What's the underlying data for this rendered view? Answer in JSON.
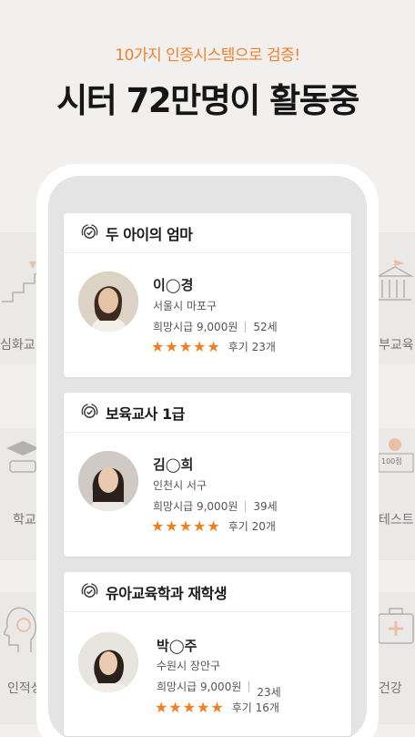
{
  "header": {
    "subtitle": "10가지 인증시스템으로 검증!",
    "title": "시터 72만명이 활동중"
  },
  "background": {
    "left_labels": [
      "심화교",
      "학교",
      "인적성"
    ],
    "right_labels": [
      "부교육",
      "테스트",
      "건강"
    ],
    "score_badge": "100점"
  },
  "cards": [
    {
      "title": "두 아이의 엄마",
      "name": "이◯경",
      "location": "서울시 마포구",
      "wage": "희망시급 9,000원",
      "age": "52세",
      "rating": 5,
      "reviews": "후기 23개"
    },
    {
      "title": "보육교사 1급",
      "name": "김◯희",
      "location": "인천시 서구",
      "wage": "희망시급 9,000원",
      "age": "39세",
      "rating": 5,
      "reviews": "후기 20개"
    },
    {
      "title": "유아교육학과 재학생",
      "name": "박◯주",
      "location": "수원시 장안구",
      "wage": "희망시급 9,000원",
      "age": "23세",
      "rating": 5,
      "reviews": "후기 16개"
    }
  ],
  "colors": {
    "accent": "#f0812a",
    "star": "#f07f22",
    "text": "#161616"
  }
}
